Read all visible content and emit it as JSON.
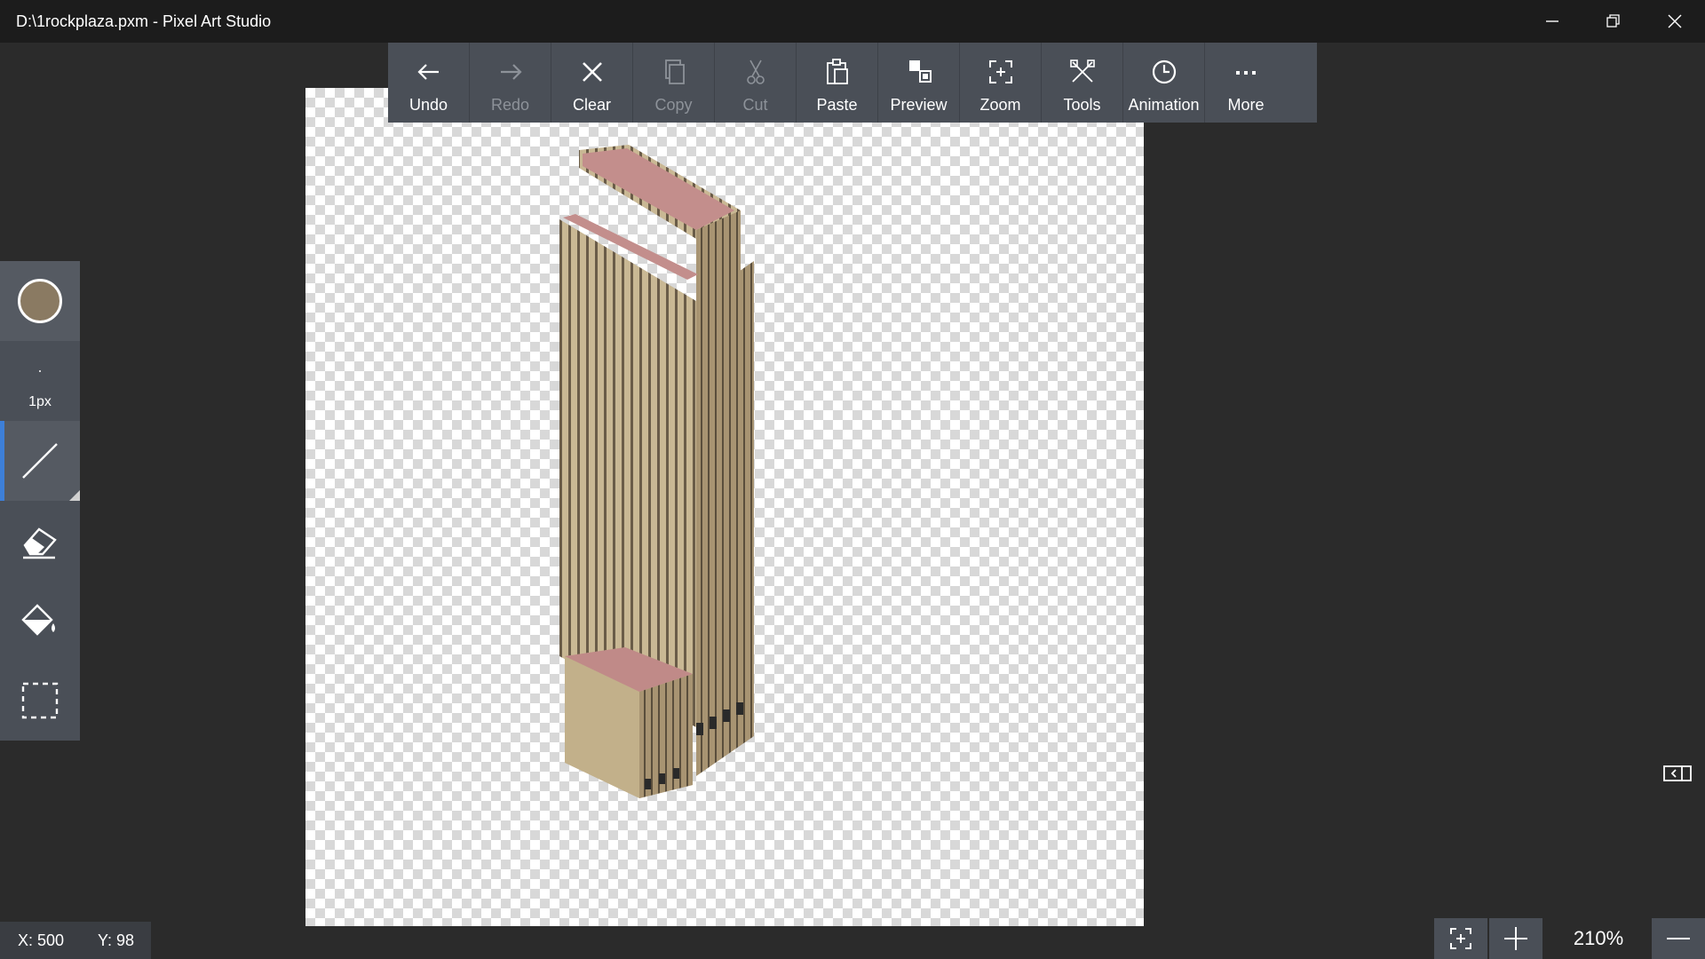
{
  "window": {
    "title": "D:\\1rockplaza.pxm - Pixel Art Studio"
  },
  "toolbar": {
    "items": [
      {
        "label": "Undo",
        "icon": "arrow-left-icon",
        "enabled": true
      },
      {
        "label": "Redo",
        "icon": "arrow-right-icon",
        "enabled": false
      },
      {
        "label": "Clear",
        "icon": "close-icon",
        "enabled": true
      },
      {
        "label": "Copy",
        "icon": "copy-icon",
        "enabled": false
      },
      {
        "label": "Cut",
        "icon": "scissors-icon",
        "enabled": false
      },
      {
        "label": "Paste",
        "icon": "paste-icon",
        "enabled": true
      },
      {
        "label": "Preview",
        "icon": "preview-icon",
        "enabled": true
      },
      {
        "label": "Zoom",
        "icon": "zoom-fit-icon",
        "enabled": true
      },
      {
        "label": "Tools",
        "icon": "tools-icon",
        "enabled": true
      },
      {
        "label": "Animation",
        "icon": "clock-icon",
        "enabled": true
      },
      {
        "label": "More",
        "icon": "more-icon",
        "enabled": true
      }
    ]
  },
  "tools": {
    "current_color": "#8a7a62",
    "brush_size": "1px",
    "selected_tool": "line"
  },
  "status": {
    "x": "X: 500",
    "y": "Y: 98",
    "zoom": "210%"
  },
  "colors": {
    "accent": "#3d7fd8",
    "building_wall": "#c2b08a",
    "building_roof": "#c08a88"
  }
}
